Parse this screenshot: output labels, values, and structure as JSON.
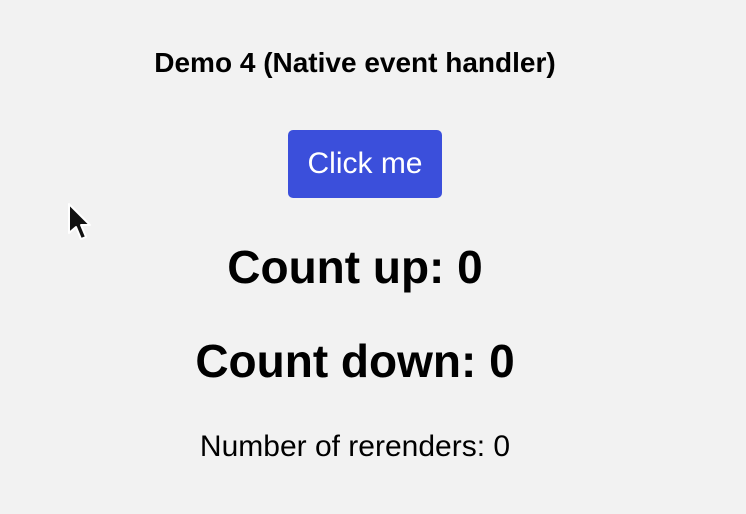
{
  "demo": {
    "title": "Demo 4 (Native event handler)",
    "button_label": "Click me",
    "count_up_text": "Count up: 0",
    "count_down_text": "Count down: 0",
    "rerenders_text": "Number of rerenders: 0"
  },
  "cursor": {
    "icon": "mouse-pointer-icon"
  },
  "colors": {
    "background": "#f2f2f2",
    "button": "#3b4fdb",
    "button_text": "#ffffff",
    "text": "#000000"
  }
}
